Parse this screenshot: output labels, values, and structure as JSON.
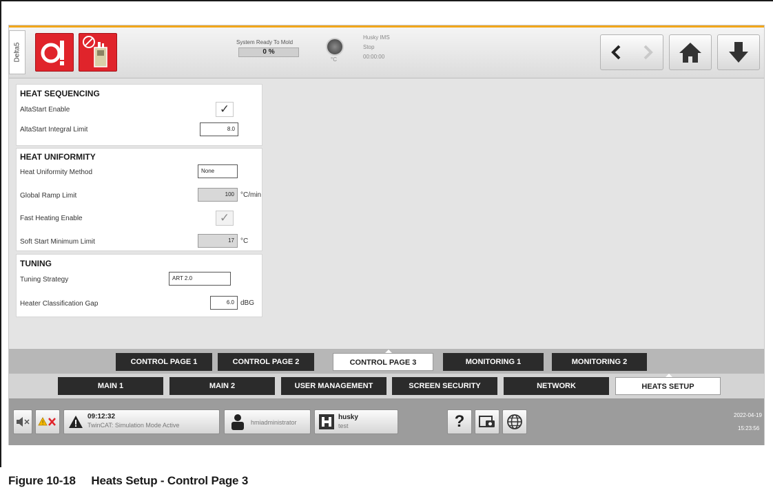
{
  "header": {
    "side_tab": "Delta5",
    "system_status": "System Ready To Mold",
    "progress_label": "0 %",
    "progress_value": 0,
    "temp_unit": "°C",
    "controller_name": "Husky IMS",
    "run_state": "Stop",
    "run_time": "00:00:00",
    "icons": [
      "heat-alarm-icon",
      "controller-disabled-icon",
      "back-arrow-icon",
      "forward-arrow-icon",
      "home-icon",
      "download-arrow-icon"
    ]
  },
  "heat_sequencing": {
    "title": "HEAT SEQUENCING",
    "altastart_enable_label": "AltaStart Enable",
    "altastart_enable_checked": true,
    "altastart_limit_label": "AltaStart Integral Limit",
    "altastart_limit_value": "8.0"
  },
  "heat_uniformity": {
    "title": "HEAT UNIFORMITY",
    "method_label": "Heat Uniformity Method",
    "method_value": "None",
    "ramp_label": "Global Ramp Limit",
    "ramp_value": "100",
    "ramp_unit": "°C/min",
    "fast_heat_label": "Fast Heating Enable",
    "fast_heat_checked": true,
    "soft_start_label": "Soft Start Minimum Limit",
    "soft_start_value": "17",
    "soft_start_unit": "°C"
  },
  "tuning": {
    "title": "TUNING",
    "strategy_label": "Tuning Strategy",
    "strategy_value": "ART 2.0",
    "gap_label": "Heater Classification Gap",
    "gap_value": "6.0",
    "gap_unit": "dBG"
  },
  "sub_tabs": [
    "CONTROL PAGE 1",
    "CONTROL PAGE 2",
    "CONTROL PAGE 3",
    "MONITORING 1",
    "MONITORING 2"
  ],
  "sub_tab_active": "CONTROL PAGE 3",
  "main_tabs": [
    "MAIN 1",
    "MAIN 2",
    "USER MANAGEMENT",
    "SCREEN SECURITY",
    "NETWORK",
    "HEATS SETUP"
  ],
  "main_tab_active": "HEATS SETUP",
  "statusbar": {
    "alarm_time": "09:12:32",
    "alarm_text": "TwinCAT: Simulation Mode Active",
    "user": "hmiadministrator",
    "mold_name": "husky",
    "mold_sub": "test",
    "date": "2022-04-19",
    "time": "15:23:56"
  },
  "caption": "Figure 10-18     Heats Setup - Control Page 3"
}
